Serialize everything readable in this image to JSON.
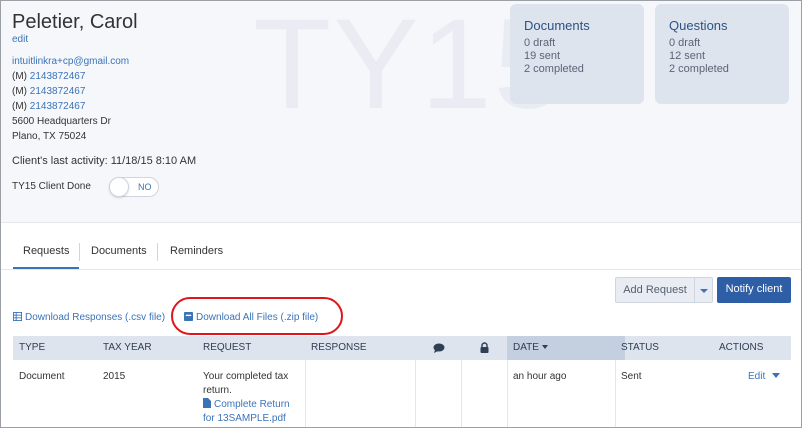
{
  "client": {
    "name": "Peletier, Carol",
    "edit_label": "edit",
    "email": "intuitlinkra+cp@gmail.com",
    "phones": [
      {
        "prefix": "(M) ",
        "number": "2143872467"
      },
      {
        "prefix": "(M) ",
        "number": "2143872467"
      },
      {
        "prefix": "(M) ",
        "number": "2143872467"
      }
    ],
    "address_line1": "5600 Headquarters Dr",
    "address_line2": "Plano, TX 75024",
    "last_activity_label": "Client's last activity:",
    "last_activity_value": " 11/18/15 8:10 AM",
    "done_label": "TY15 Client Done",
    "done_toggle": "NO"
  },
  "watermark": "TY15",
  "documents_card": {
    "title": "Documents",
    "draft": "0 draft",
    "sent": "19 sent",
    "completed": "2 completed"
  },
  "questions_card": {
    "title": "Questions",
    "draft": "0 draft",
    "sent": "12 sent",
    "completed": "2 completed"
  },
  "tabs": [
    {
      "label": "Requests",
      "active": true
    },
    {
      "label": "Documents",
      "active": false
    },
    {
      "label": "Reminders",
      "active": false
    }
  ],
  "buttons": {
    "add_request": "Add Request",
    "notify_client": "Notify client"
  },
  "downloads": {
    "responses": "Download Responses (.csv file)",
    "all_files": "Download All Files (.zip file)"
  },
  "table": {
    "headers": {
      "type": "TYPE",
      "tax_year": "TAX YEAR",
      "request": "REQUEST",
      "response": "RESPONSE",
      "date": "DATE",
      "status": "STATUS",
      "actions": "ACTIONS"
    },
    "rows": [
      {
        "type": "Document",
        "tax_year": "2015",
        "request_line1": "Your completed tax",
        "request_line2": "return.",
        "attachment_line1": "Complete Return",
        "attachment_line2": "for 13SAMPLE.pdf",
        "response": "",
        "date": "an hour ago",
        "status": "Sent",
        "action": "Edit"
      }
    ]
  },
  "colors": {
    "link": "#3b73b9",
    "primary_button": "#2d5ea6",
    "card_bg": "#dde4ee",
    "highlight": "#e0141b"
  }
}
